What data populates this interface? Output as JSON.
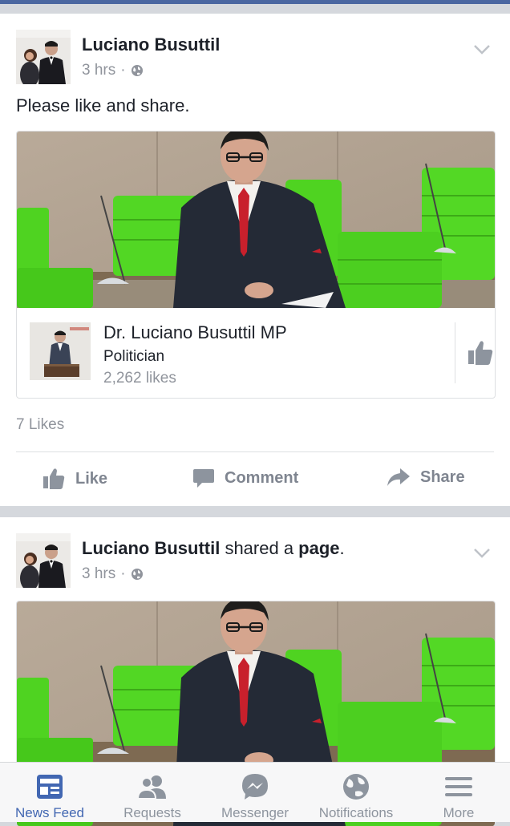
{
  "feed": {
    "posts": [
      {
        "author": "Luciano Busuttil",
        "time": "3 hrs",
        "separator": "·",
        "text": "Please like and share.",
        "page_card": {
          "name": "Dr. Luciano Busuttil MP",
          "category": "Politician",
          "likes": "2,262 likes"
        },
        "likes": "7 Likes",
        "actions": {
          "like": "Like",
          "comment": "Comment",
          "share": "Share"
        }
      },
      {
        "author": "Luciano Busuttil",
        "verb": " shared a ",
        "object": "page",
        "end": ".",
        "time": "3 hrs",
        "separator": "·"
      }
    ]
  },
  "tabbar": {
    "tabs": [
      {
        "label": "News Feed",
        "icon": "news-feed-icon",
        "active": true
      },
      {
        "label": "Requests",
        "icon": "friend-requests-icon",
        "active": false
      },
      {
        "label": "Messenger",
        "icon": "messenger-icon",
        "active": false
      },
      {
        "label": "Notifications",
        "icon": "globe-notifications-icon",
        "active": false
      },
      {
        "label": "More",
        "icon": "menu-icon",
        "active": false
      }
    ]
  },
  "colors": {
    "brand": "#4267b2",
    "accent_green": "#3fc21c",
    "muted": "#90949c"
  }
}
